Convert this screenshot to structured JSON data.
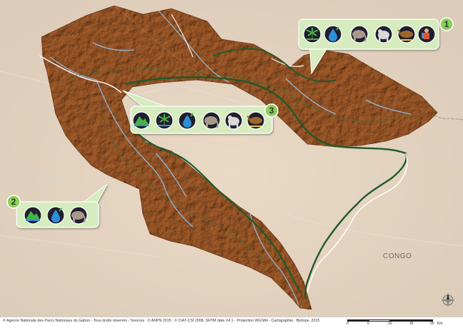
{
  "map": {
    "country_label": "CONGO",
    "badges": [
      {
        "number": "1",
        "icons": [
          "palm-icon",
          "water-drop-icon",
          "elephant-icon",
          "gorilla-icon",
          "buffalo-icon",
          "ranger-icon"
        ]
      },
      {
        "number": "2",
        "icons": [
          "mountain-icon",
          "water-drop-icon",
          "elephant-icon"
        ]
      },
      {
        "number": "3",
        "icons": [
          "mountain-icon",
          "palm-icon",
          "water-drop-icon",
          "elephant-icon",
          "gorilla-icon",
          "buffalo-icon"
        ]
      }
    ]
  },
  "colors": {
    "background": "#e6d7c6",
    "park_fill": "#a85f2c",
    "park_edge": "#7a3f17",
    "boundary": "#1e5a2a",
    "river": "#8fb6d8",
    "callout_fill": "#d6ecbf",
    "badge_fill": "#8bcf58"
  },
  "footer": {
    "credits": "© Agence Nationale des Parcs Nationaux du Gabon - Tous droits réservés - Sources : © ANPN 2015 ; © CIAT-CSI 2008, SRTM data V4.1  -  Projection WGS84 - Cartographie : Biotope, 2015",
    "scale_labels": [
      "0",
      "5",
      "10",
      "15",
      "20"
    ],
    "scale_unit": "Km"
  }
}
